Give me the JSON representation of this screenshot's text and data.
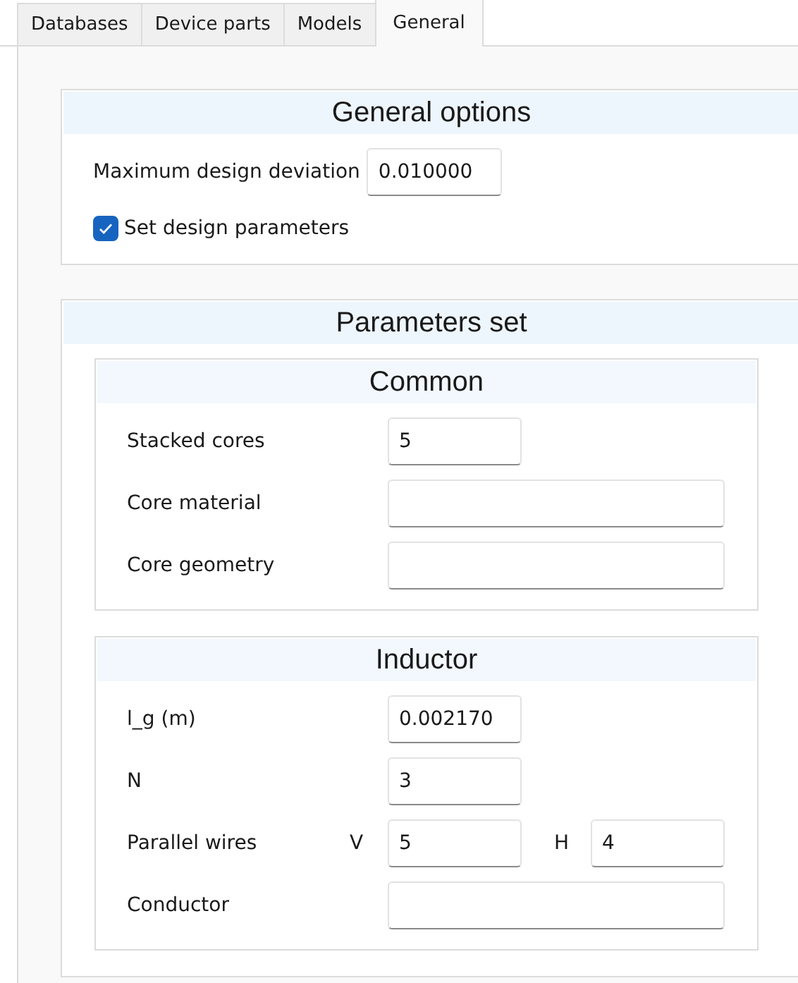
{
  "tabs": [
    {
      "label": "Databases",
      "selected": false
    },
    {
      "label": "Device parts",
      "selected": false
    },
    {
      "label": "Models",
      "selected": false
    },
    {
      "label": "General",
      "selected": true
    }
  ],
  "general_options": {
    "title": "General options",
    "fields": [
      {
        "label": "Maximum design deviation",
        "value": "0.010000"
      }
    ],
    "checkbox": {
      "label": "Set design parameters",
      "checked": true
    }
  },
  "parameters_set": {
    "title": "Parameters set",
    "groups": [
      {
        "title": "Common",
        "rows": [
          {
            "label": "Stacked cores",
            "fields": [
              {
                "kind": "short",
                "value": "5"
              }
            ]
          },
          {
            "label": "Core material",
            "fields": [
              {
                "kind": "long"
              }
            ]
          },
          {
            "label": "Core geometry",
            "fields": [
              {
                "kind": "long"
              }
            ]
          }
        ]
      },
      {
        "title": "Inductor",
        "rows": [
          {
            "label": "l_g (m)",
            "fields": [
              {
                "kind": "short",
                "value": "0.002170"
              }
            ]
          },
          {
            "label": "N",
            "fields": [
              {
                "kind": "short",
                "value": "3"
              }
            ]
          },
          {
            "label": "Parallel wires",
            "fields": [
              {
                "kind": "short",
                "prefix": "V",
                "value": "5"
              },
              {
                "kind": "short",
                "prefix": "H",
                "value": "4"
              }
            ]
          },
          {
            "label": "Conductor",
            "fields": [
              {
                "kind": "long"
              }
            ]
          }
        ]
      }
    ]
  }
}
